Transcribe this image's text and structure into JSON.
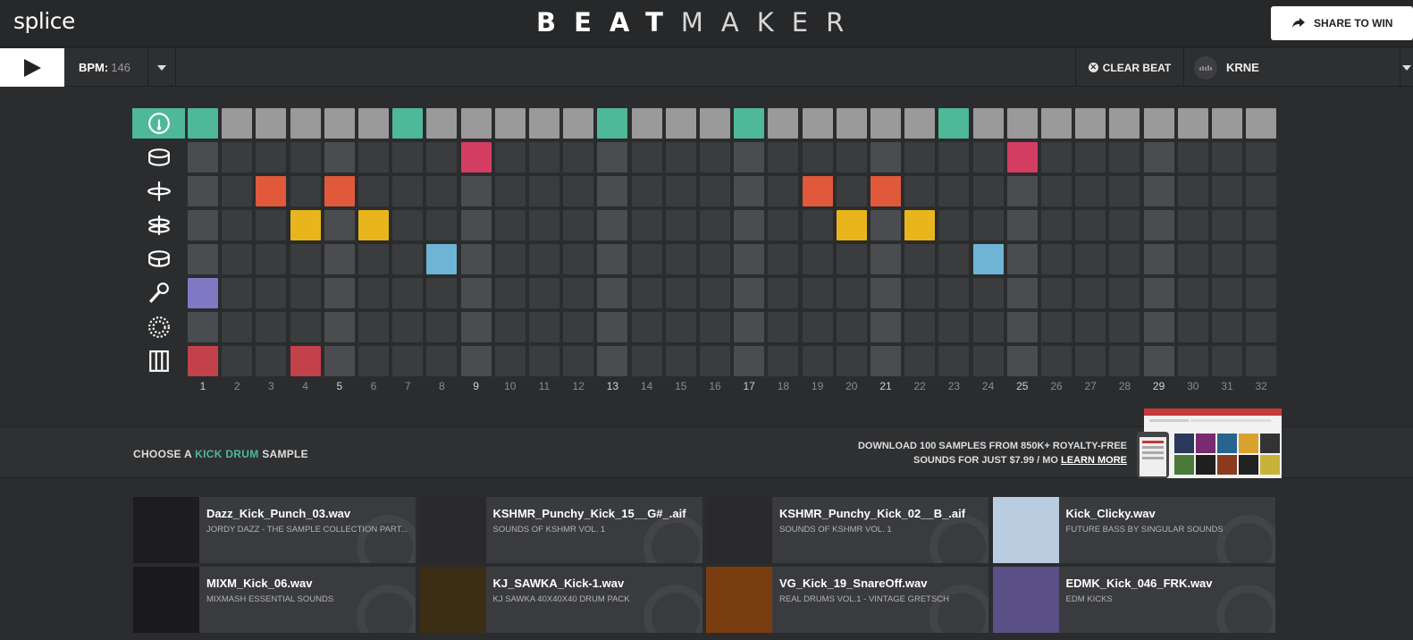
{
  "header": {
    "logo": "splice",
    "title_bold": "BEAT",
    "title_light": "MAKER",
    "share_label": "SHARE TO WIN"
  },
  "toolbar": {
    "bpm_label": "BPM:",
    "bpm_value": "146",
    "clear_label": "CLEAR BEAT",
    "kit_name": "KRNE"
  },
  "colors": {
    "accent": "#4eb898",
    "kick": "#4eb898",
    "snare": "#d43d62",
    "hat_closed": "#e0593a",
    "hat_open": "#e8b61c",
    "tom": "#6fb4d4",
    "vocal": "#7f79c4",
    "fx": "#8a8a8a",
    "keys": "#c2414b"
  },
  "sequencer": {
    "steps": 32,
    "rows": [
      {
        "name": "kick",
        "icon": "kick-drum-icon",
        "active": [
          1,
          7,
          13,
          17,
          23
        ]
      },
      {
        "name": "snare",
        "icon": "snare-drum-icon",
        "active": [
          9,
          25
        ]
      },
      {
        "name": "hihat-closed",
        "icon": "hihat-closed-icon",
        "active": [
          3,
          5,
          19,
          21
        ]
      },
      {
        "name": "hihat-open",
        "icon": "hihat-open-icon",
        "active": [
          4,
          6,
          20,
          22
        ]
      },
      {
        "name": "tom",
        "icon": "tom-icon",
        "active": [
          8,
          24
        ]
      },
      {
        "name": "vocal",
        "icon": "microphone-icon",
        "active": [
          1
        ]
      },
      {
        "name": "fx",
        "icon": "fx-icon",
        "active": []
      },
      {
        "name": "keys",
        "icon": "keys-icon",
        "active": [
          1,
          4
        ]
      }
    ],
    "step_labels": [
      "1",
      "2",
      "3",
      "4",
      "5",
      "6",
      "7",
      "8",
      "9",
      "10",
      "11",
      "12",
      "13",
      "14",
      "15",
      "16",
      "17",
      "18",
      "19",
      "20",
      "21",
      "22",
      "23",
      "24",
      "25",
      "26",
      "27",
      "28",
      "29",
      "30",
      "31",
      "32"
    ]
  },
  "chooser": {
    "prefix": "CHOOSE A",
    "instrument": "KICK DRUM",
    "suffix": "SAMPLE",
    "promo_line1": "DOWNLOAD 100 SAMPLES FROM 850K+ ROYALTY-FREE",
    "promo_line2": "SOUNDS FOR JUST $7.99 / MO",
    "promo_link": "LEARN MORE"
  },
  "samples": [
    {
      "name": "Dazz_Kick_Punch_03.wav",
      "pack": "JORDY DAZZ - THE SAMPLE COLLECTION PART...",
      "thumb_color": "#1d1d1f"
    },
    {
      "name": "KSHMR_Punchy_Kick_15__G#_.aif",
      "pack": "SOUNDS OF KSHMR VOL. 1",
      "thumb_color": "#2a2a2c"
    },
    {
      "name": "KSHMR_Punchy_Kick_02__B_.aif",
      "pack": "SOUNDS OF KSHMR VOL. 1",
      "thumb_color": "#2a2a2c"
    },
    {
      "name": "Kick_Clicky.wav",
      "pack": "FUTURE BASS BY SINGULAR SOUNDS",
      "thumb_color": "#b9cce0"
    },
    {
      "name": "MIXM_Kick_06.wav",
      "pack": "MIXMASH ESSENTIAL SOUNDS",
      "thumb_color": "#1a1a1c"
    },
    {
      "name": "KJ_SAWKA_Kick-1.wav",
      "pack": "KJ SAWKA 40X40X40 DRUM PACK",
      "thumb_color": "#3b2e14"
    },
    {
      "name": "VG_Kick_19_SnareOff.wav",
      "pack": "REAL DRUMS VOL.1 - VINTAGE GRETSCH",
      "thumb_color": "#7a3d10"
    },
    {
      "name": "EDMK_Kick_046_FRK.wav",
      "pack": "EDM KICKS",
      "thumb_color": "#5a4f86"
    }
  ]
}
